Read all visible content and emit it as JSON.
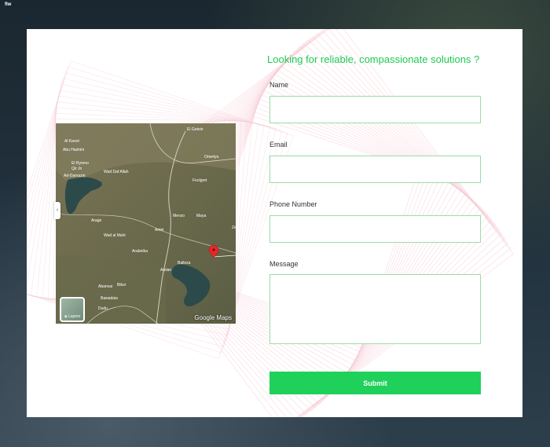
{
  "corner_mark": "flw",
  "form": {
    "title": "Looking for reliable, compassionate solutions ?",
    "fields": [
      {
        "label": "Name",
        "value": ""
      },
      {
        "label": "Email",
        "value": ""
      },
      {
        "label": "Phone Number",
        "value": ""
      },
      {
        "label": "Message",
        "value": ""
      }
    ],
    "submit_label": "Submit"
  },
  "map": {
    "credit": "Google Maps",
    "layers_label": "Layers",
    "toggle_icon": "chevron-left-icon",
    "marker_icon": "map-pin-icon",
    "places": [
      "El Getein",
      "Al Karori",
      "Abu Hashim",
      "El Ryreno",
      "Qir Jn",
      "Wad Daf Allah",
      "Ad-Damazin",
      "Orwelya",
      "Feolgret",
      "Arage",
      "Menzo",
      "Maya",
      "Wad al Mahi",
      "Amiri",
      "Arabeiba",
      "Balleza",
      "Amlan",
      "Abanvai",
      "Bikor",
      "Bawadaia",
      "Dudu",
      "Ze"
    ]
  },
  "colors": {
    "accent": "#1ec956",
    "button": "#1fd15b",
    "input_border": "#9bdca8",
    "pattern": "#f6c9d3",
    "marker": "#e02a2a"
  }
}
